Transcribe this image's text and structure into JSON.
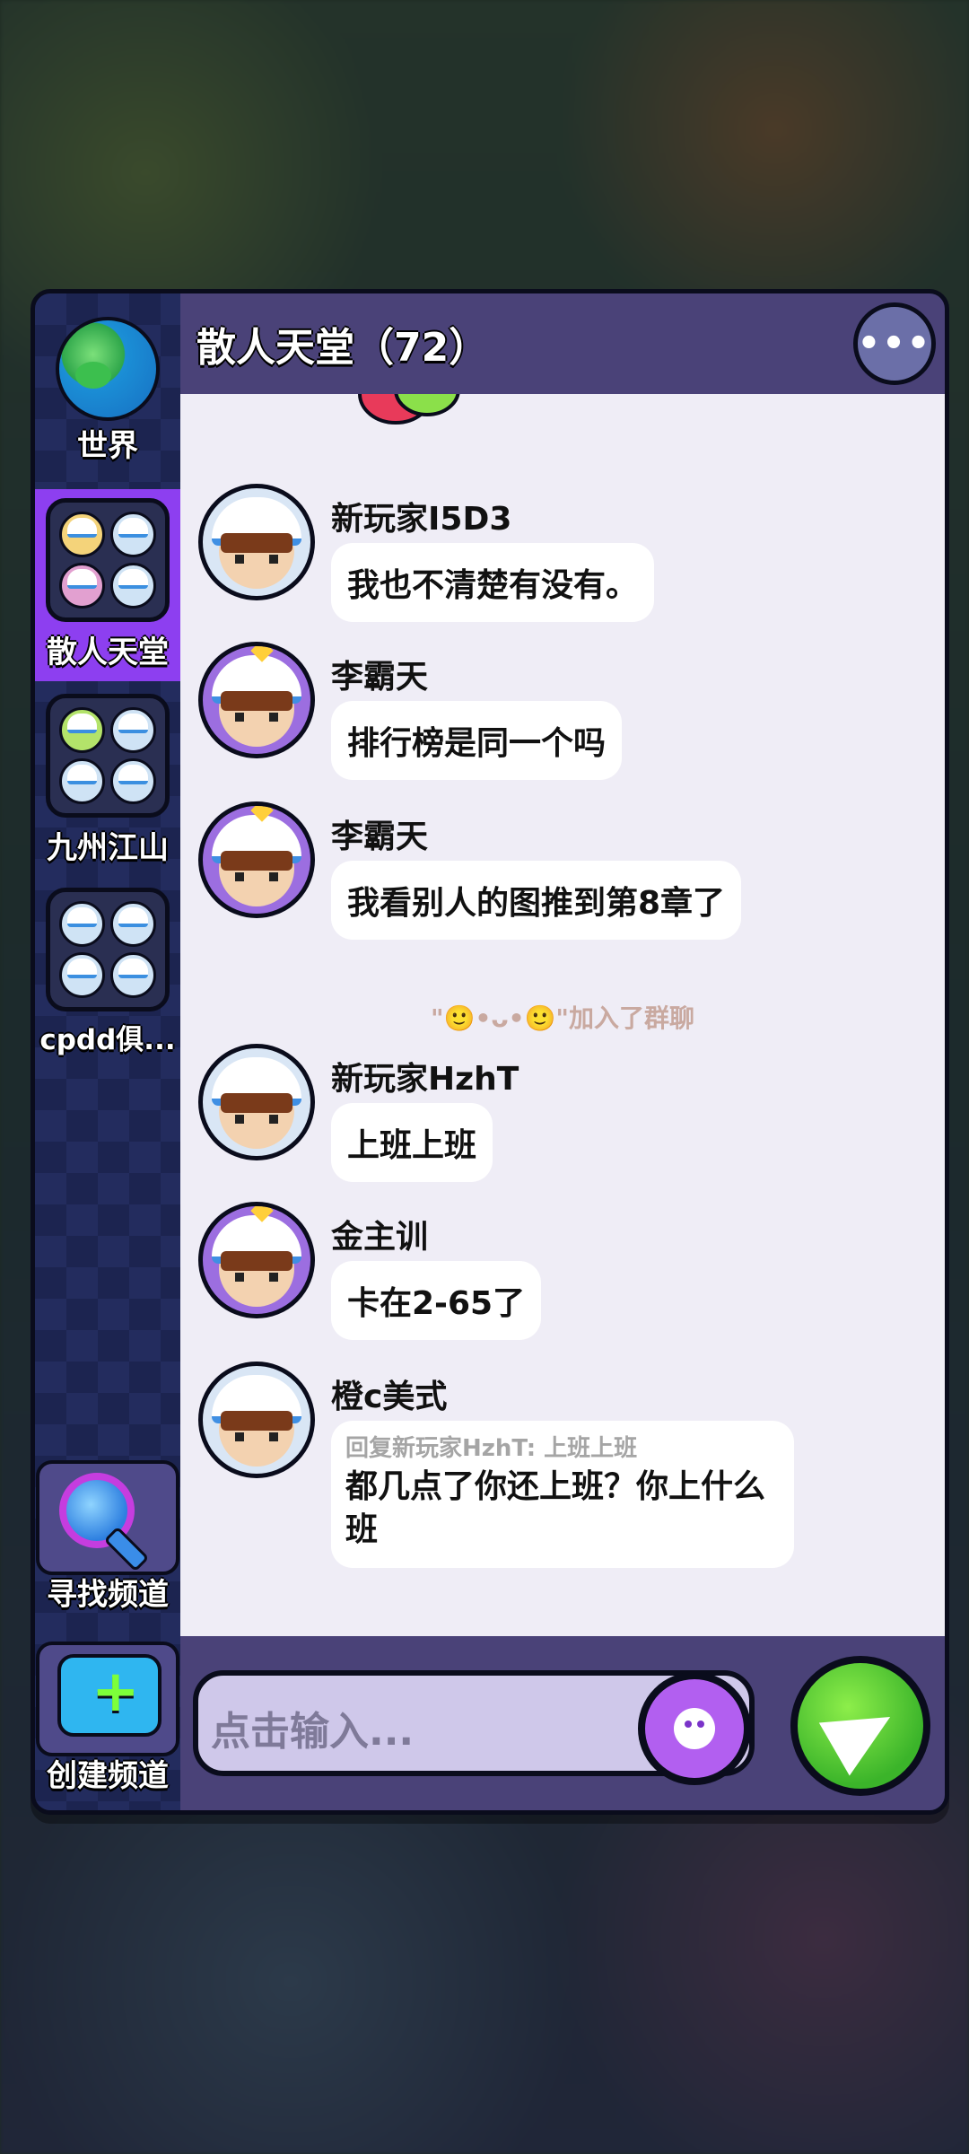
{
  "sidebar": {
    "world_label": "世界",
    "channels": [
      {
        "label": "散人天堂",
        "active": true
      },
      {
        "label": "九州江山",
        "active": false
      },
      {
        "label": "cpdd俱...",
        "active": false
      }
    ],
    "find_channel_label": "寻找频道",
    "create_channel_label": "创建频道"
  },
  "header": {
    "title": "散人天堂（72）",
    "more_icon": "more-dots-icon"
  },
  "messages": [
    {
      "name": "新玩家I5D3",
      "text": "我也不清楚有没有。"
    },
    {
      "name": "李霸天",
      "text": "排行榜是同一个吗"
    },
    {
      "name": "李霸天",
      "text": "我看别人的图推到第8章了"
    },
    {
      "name": "新玩家HzhT",
      "text": "上班上班"
    },
    {
      "name": "金主训",
      "text": "卡在2-65了"
    },
    {
      "name": "橙c美式",
      "reply_quote": "回复新玩家HzhT: 上班上班",
      "text": "都几点了你还上班？你上什么班"
    }
  ],
  "system_notice": "\"🙂•ᴗ•🙂\"加入了群聊",
  "input": {
    "placeholder": "点击输入..."
  },
  "colors": {
    "accent_purple": "#8d3ff0",
    "header_bg": "#4a4278",
    "chat_bg": "#efedf6",
    "send_green": "#3bb42a"
  }
}
